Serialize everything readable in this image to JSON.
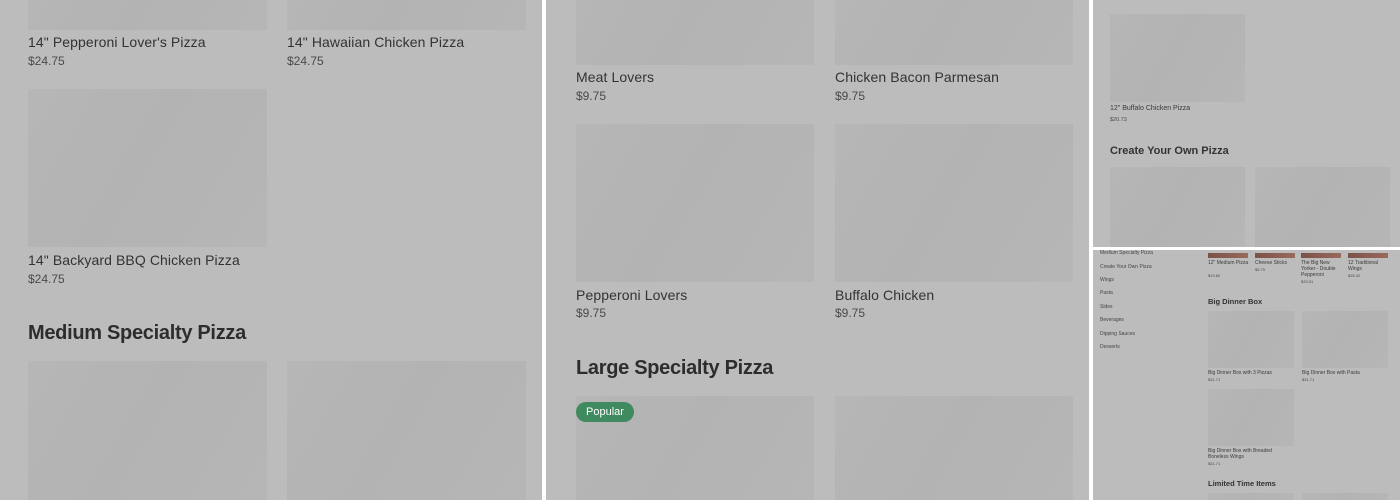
{
  "panel1": {
    "items_top": [
      {
        "name": "14\" Pepperoni Lover's Pizza",
        "price": "$24.75"
      },
      {
        "name": "14\" Hawaiian Chicken Pizza",
        "price": "$24.75"
      },
      {
        "name": "14\" Backyard BBQ Chicken Pizza",
        "price": "$24.75"
      }
    ],
    "section_heading": "Medium Specialty Pizza"
  },
  "panel2": {
    "items": [
      {
        "name": "Meat Lovers",
        "price": "$9.75"
      },
      {
        "name": "Chicken Bacon Parmesan",
        "price": "$9.75"
      },
      {
        "name": "Pepperoni Lovers",
        "price": "$9.75"
      },
      {
        "name": "Buffalo Chicken",
        "price": "$9.75"
      }
    ],
    "section_heading": "Large Specialty Pizza",
    "badge": "Popular"
  },
  "panel3": {
    "item": {
      "name": "12\" Buffalo Chicken Pizza",
      "price": "$20.73"
    },
    "section_heading": "Create Your Own Pizza"
  },
  "panel4": {
    "nav": [
      "Medium Specialty Pizza",
      "Create Your Own Pizza",
      "Wings",
      "Pasta",
      "Sides",
      "Beverages",
      "Dipping Sauces",
      "Desserts"
    ],
    "top_items": [
      {
        "name": "12\" Medium Pizza",
        "price": "$19.60"
      },
      {
        "name": "Cheese Sticks",
        "price": "$9.75"
      },
      {
        "name": "The Big New Yorker - Double Pepperoni",
        "price": "$33.51"
      },
      {
        "name": "12 Traditional Wings",
        "price": "$26.32"
      }
    ],
    "section_big_dinner": "Big Dinner Box",
    "dinner_items": [
      {
        "name": "Big Dinner Box with 3 Pizzas",
        "price": "$31.71"
      },
      {
        "name": "Big Dinner Box with Pasta",
        "price": "$31.71"
      },
      {
        "name": "Big Dinner Box with Breaded Boneless Wings",
        "price": "$31.71"
      }
    ],
    "section_limited": "Limited Time Items"
  }
}
